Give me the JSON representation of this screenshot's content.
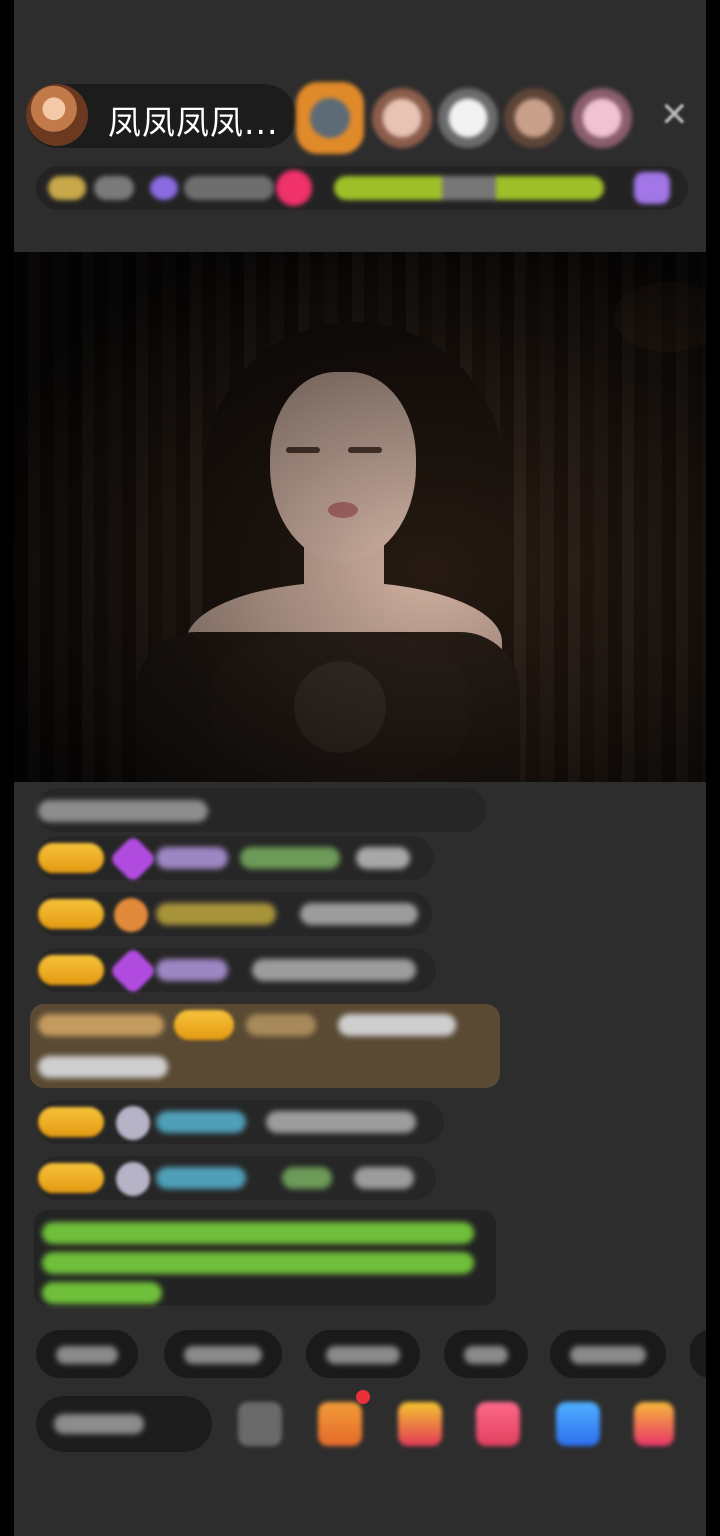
{
  "header": {
    "host_name": "凤凤凤凤...",
    "close_glyph": "✕",
    "viewers": [
      {
        "color": "#e08a2a",
        "icon": "rank-frame-avatar"
      },
      {
        "color": "#c99a88",
        "icon": "avatar"
      },
      {
        "color": "#d8d8d8",
        "icon": "avatar"
      },
      {
        "color": "#b99078",
        "icon": "avatar"
      },
      {
        "color": "#d7a9b9",
        "icon": "avatar"
      }
    ]
  },
  "colors": {
    "badge_gold": "#f2b02a",
    "gem_purple": "#b14be0",
    "rich_message_bg": "#5a4a34",
    "notice_text_green": "#6fbf3a",
    "close_gray": "#bdbdbd"
  },
  "chat": {
    "messages": [
      {
        "type": "system"
      },
      {
        "type": "user",
        "badge": "gold",
        "icon": "gem-icon"
      },
      {
        "type": "user",
        "badge": "gold",
        "icon": "gift-icon"
      },
      {
        "type": "user",
        "badge": "gold",
        "icon": "gem-icon"
      },
      {
        "type": "highlighted"
      },
      {
        "type": "user",
        "badge": "gold",
        "icon": "avatar-icon"
      },
      {
        "type": "user",
        "badge": "gold",
        "icon": "avatar-icon"
      },
      {
        "type": "notice"
      }
    ]
  },
  "bottom_bar": {
    "actions": [
      "message-icon",
      "gift-box-icon",
      "gift-icon",
      "lucky-bag-icon",
      "share-icon",
      "more-icon"
    ]
  }
}
